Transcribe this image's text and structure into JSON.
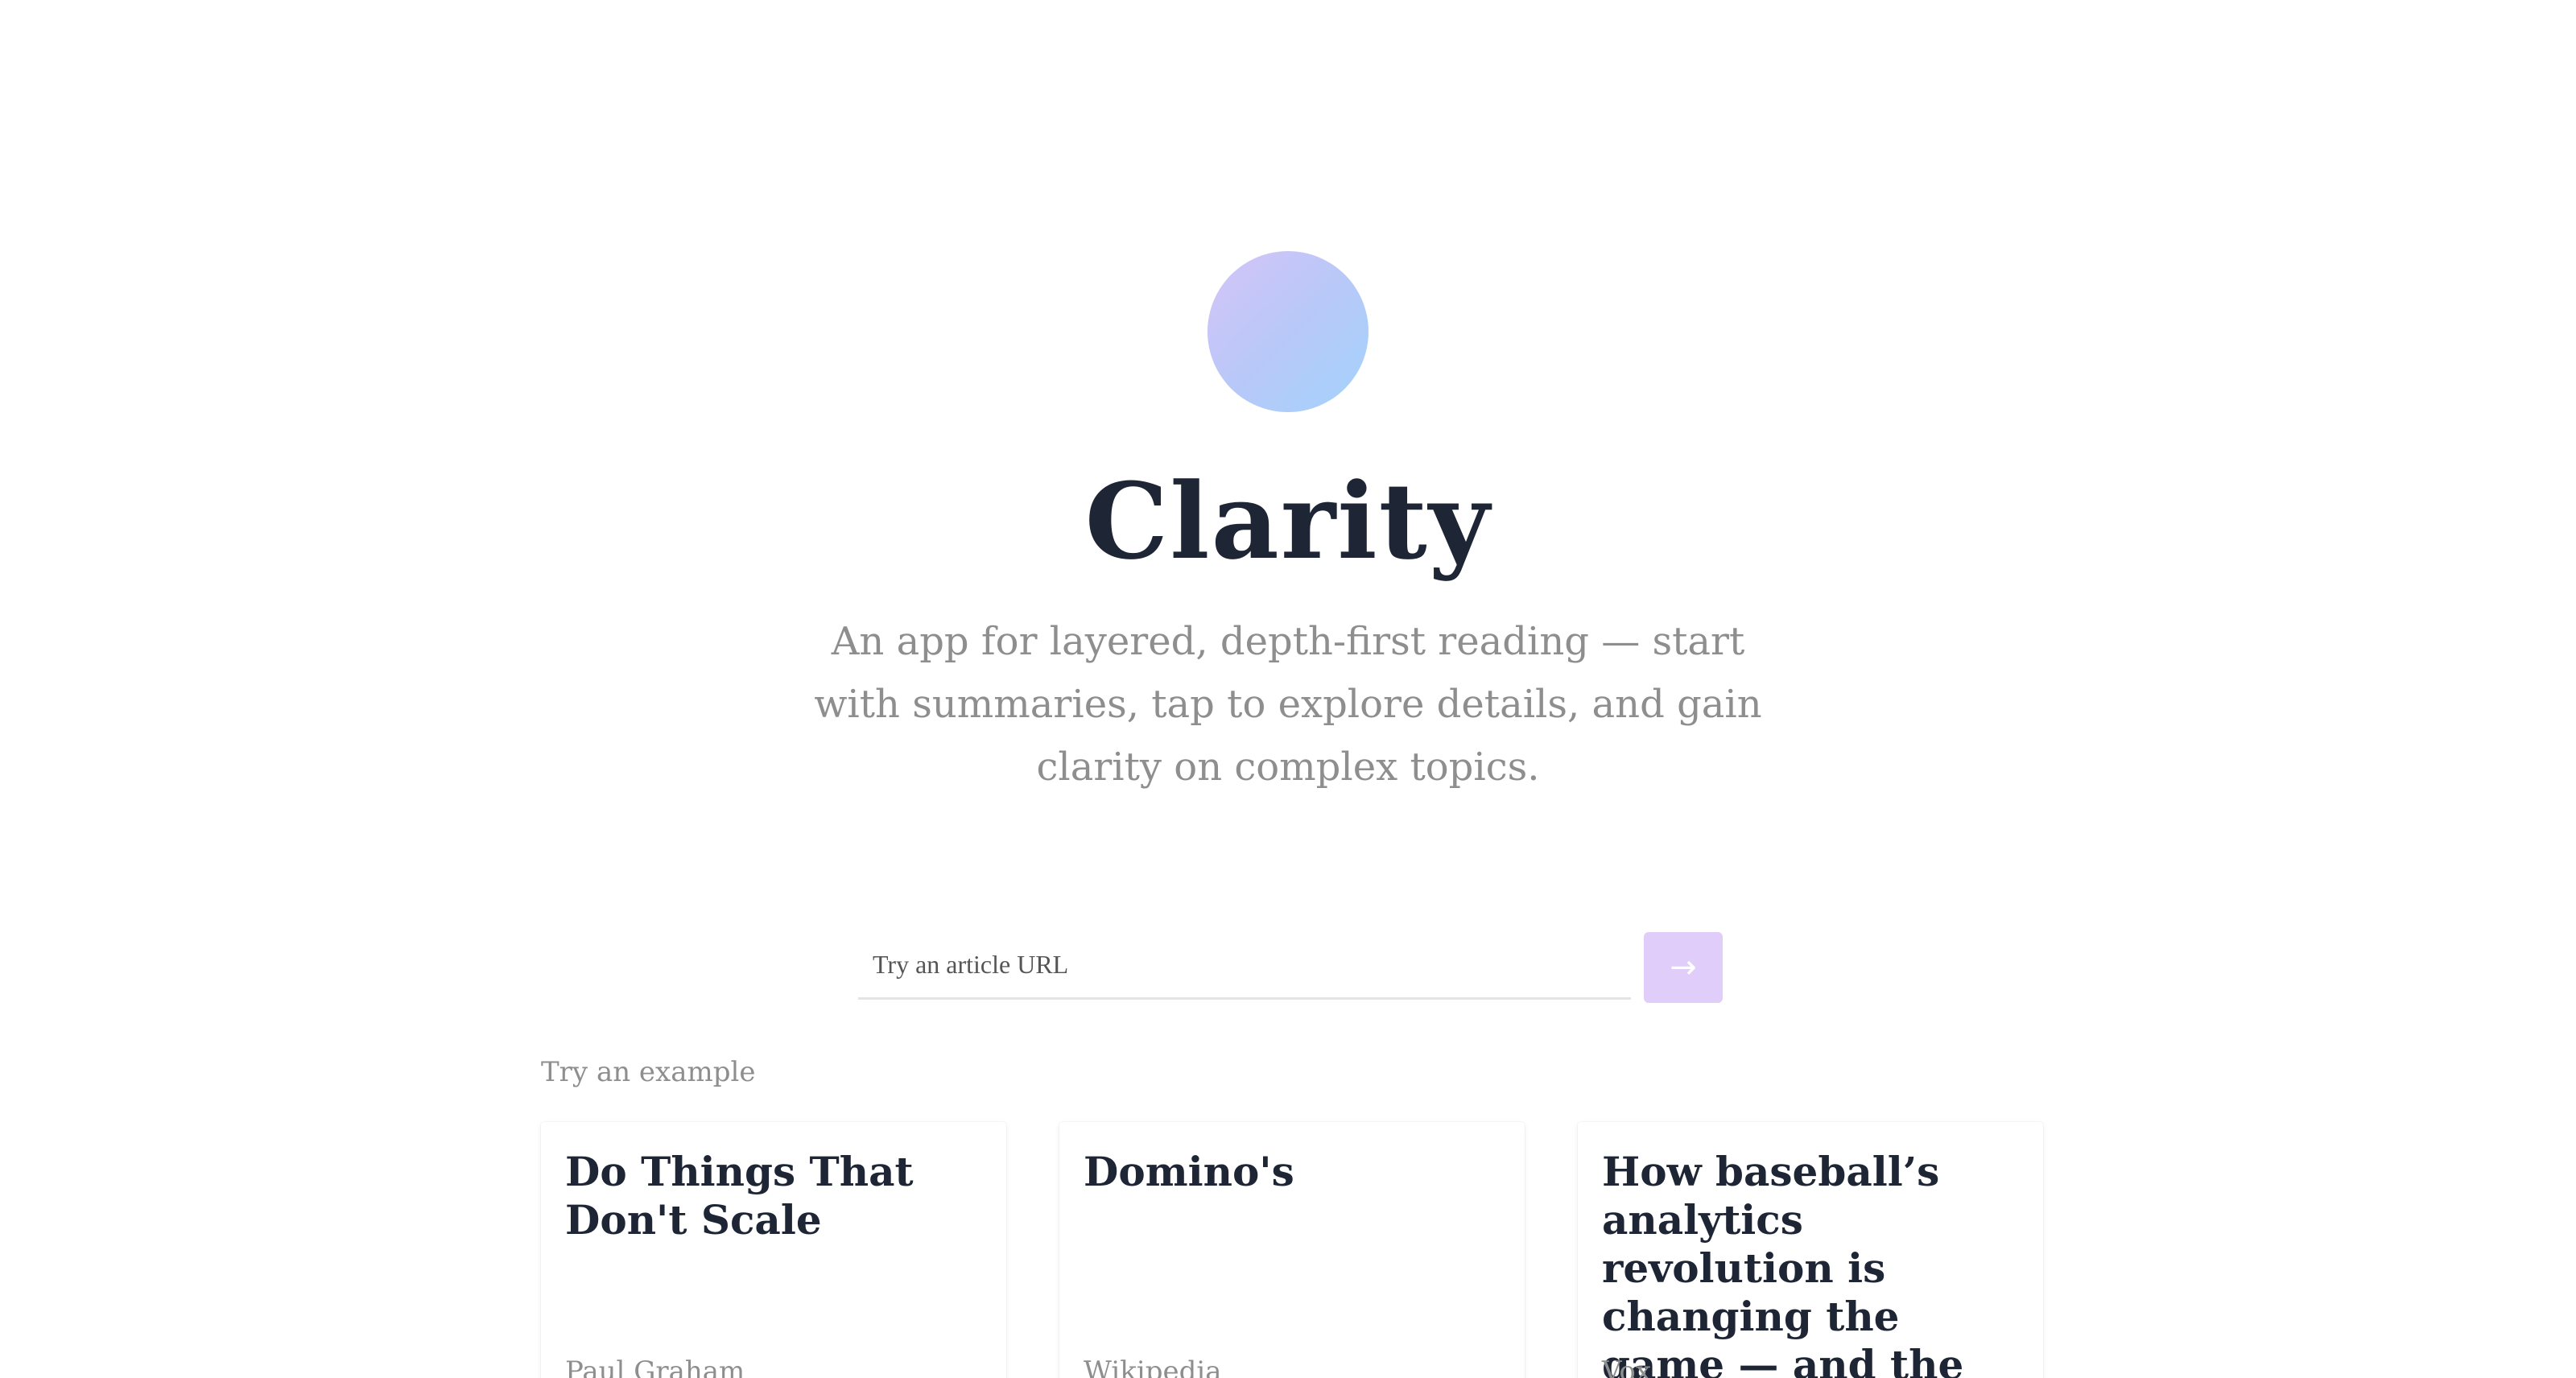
{
  "hero": {
    "logo_icon": "gradient-orb-logo",
    "title": "Clarity",
    "tagline": "An app for layered, depth-first reading — start with summaries, tap to explore details, and gain clarity on complex topics."
  },
  "url_form": {
    "placeholder": "Try an article URL",
    "value": "",
    "submit_label": "→",
    "submit_icon": "arrow-right-icon"
  },
  "examples": {
    "label": "Try an example",
    "cards": [
      {
        "title": "Do Things That Don't Scale",
        "source": "Paul Graham"
      },
      {
        "title": "Domino's",
        "source": "Wikipedia"
      },
      {
        "title": "How baseball’s analytics revolution is changing the game — and the players",
        "source": "Vox"
      }
    ]
  },
  "colors": {
    "title": "#1e2535",
    "muted_text": "#8e8e8e",
    "accent_button": "#e0cdf9",
    "orb_gradient_start": "#d6c4f7",
    "orb_gradient_end": "#a3d3fb"
  }
}
